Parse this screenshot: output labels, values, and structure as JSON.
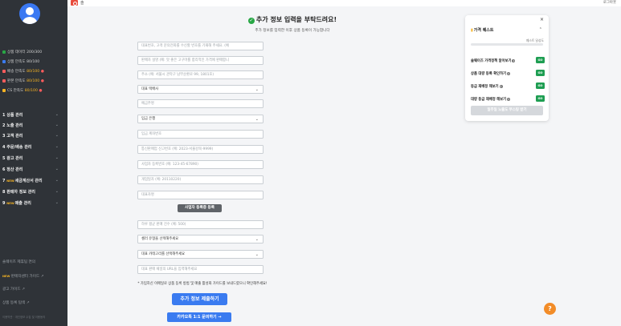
{
  "topbar": {
    "logo_text": "솔",
    "logout": "로그아웃"
  },
  "sidebar": {
    "stats": [
      {
        "prefix": "상품 데이터 ",
        "value": "200/300",
        "dot_color": "#28a745",
        "hl": ""
      },
      {
        "prefix": "상품 만족도 ",
        "value": "80/100",
        "dot_color": "#3a7bf0",
        "hl": ""
      },
      {
        "prefix": "배송 만족도 ",
        "value": "80/100",
        "dot_color": "#ff5c5c",
        "hl": "yellow"
      },
      {
        "prefix": "판본 만족도 ",
        "value": "80/100",
        "dot_color": "#ff5c5c",
        "hl": "yellow"
      },
      {
        "prefix": "CS 만족도 ",
        "value": "80/100",
        "dot_color": "#f5b323",
        "hl": "yellow"
      }
    ],
    "menu": [
      {
        "num": "1",
        "label": "상품 관리",
        "new": ""
      },
      {
        "num": "2",
        "label": "노출 관리",
        "new": ""
      },
      {
        "num": "3",
        "label": "고객 관리",
        "new": ""
      },
      {
        "num": "4",
        "label": "주문/배송 관리",
        "new": ""
      },
      {
        "num": "5",
        "label": "광고 관리",
        "new": ""
      },
      {
        "num": "6",
        "label": "정산 관리",
        "new": ""
      },
      {
        "num": "7",
        "label": "세금계산서 관리",
        "new": "NEW"
      },
      {
        "num": "8",
        "label": "판매자 정보 관리",
        "new": ""
      },
      {
        "num": "9",
        "label": "매출 관리",
        "new": "NEW"
      }
    ],
    "footer": {
      "meeting": "솔웨이즈 제휴팀 면의",
      "seller_guide_new": "NEW",
      "seller_guide": "판매자센터 가이드 ↗",
      "ad_guide": "광고 가이드 ↗",
      "upload_guide": "상품 등록 탐색 ↗",
      "legal": "이용약관 · 개인정보 수집 및 이용동의"
    }
  },
  "main": {
    "title": "추가 정보 입력을 부탁드려요!",
    "subtitle": "추가 정보를 입력한 이후 상품 등록이 가능합니다",
    "fields": [
      {
        "type": "input",
        "placeholder": "대표번호, 고객 문의전화를 수신할 번호를 기재해 주세요. (예"
      },
      {
        "type": "input",
        "placeholder": "판매자 설명 (예: 맛 좋은 고구마를 합리적인 가격에 판매합니"
      },
      {
        "type": "input",
        "placeholder": "주소 (예: 서울시 관악구 남부순환로 99, 1801호)"
      },
      {
        "type": "select",
        "value": "대표 택배사"
      },
      {
        "type": "input",
        "placeholder": "예금주명"
      },
      {
        "type": "select",
        "value": "입금 은행"
      },
      {
        "type": "input",
        "placeholder": "입금 계좌번호"
      },
      {
        "type": "input",
        "placeholder": "통신판매업 신고번호 (예: 2023-서울강북-9999)"
      },
      {
        "type": "input",
        "placeholder": "사업자 등록번호 (예: 123-45-67890)"
      },
      {
        "type": "input",
        "placeholder": "개업일자 (예: 20110220)"
      },
      {
        "type": "input",
        "placeholder": "대표자명"
      }
    ],
    "biz_cert_button": "사업자 등록증 등록",
    "fields2": [
      {
        "type": "input",
        "placeholder": "하루 평균 판매 건수 (예: 500)"
      },
      {
        "type": "select",
        "value": "셀러 유형을 선택해주세요"
      },
      {
        "type": "select",
        "value": "대표 카테고리를 선택해주세요"
      },
      {
        "type": "input",
        "placeholder": "대표 판매 채널의 URL을 입력해주세요"
      }
    ],
    "notice": "* 가입하신 이메일로 상품 등록 방법 및 매출 활성화 가이드를 보내드렸으니 확인해주세요!",
    "submit_button": "추가 정보 제출하기",
    "kakao_button": "카카오톡 1:1 문의하기 →"
  },
  "panel": {
    "close": "×",
    "title_icon": "💡",
    "title": "가격 퀘스트",
    "collapse": "^",
    "progress_label": "퀘스트 달성도",
    "progress": 0,
    "quests": [
      {
        "label": "솔웨이즈 가격정책 알아보기",
        "go": "GO"
      },
      {
        "label": "상품 대량 등록 확인하기",
        "go": "GO"
      },
      {
        "label": "등급 재배정 해보기",
        "go": "GO"
      },
      {
        "label": "대량 등급 재배정 해보기",
        "go": "GO"
      }
    ],
    "bottom_button": "일주일 노출도 부스팅 받기"
  },
  "help": "?"
}
